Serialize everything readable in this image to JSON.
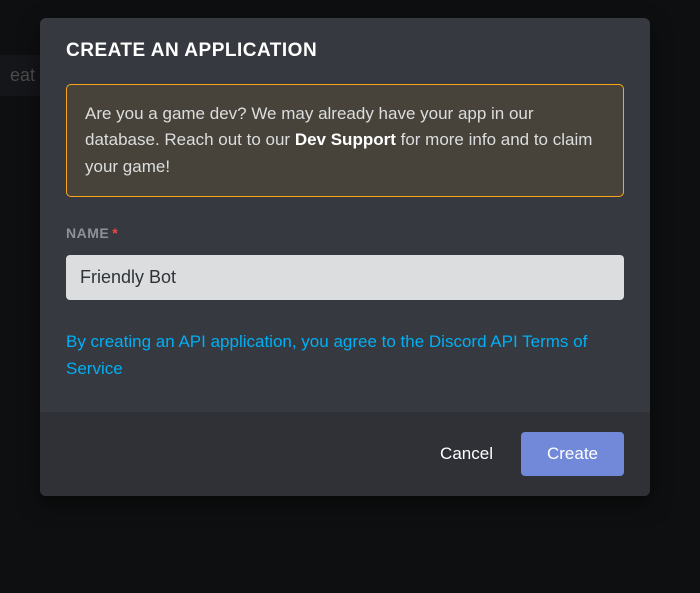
{
  "background": {
    "partial_text": "eat"
  },
  "modal": {
    "title": "CREATE AN APPLICATION",
    "notice": {
      "text_before": "Are you a game dev? We may already have your app in our database. Reach out to our ",
      "bold_text": "Dev Support",
      "text_after": " for more info and to claim your game!"
    },
    "name_field": {
      "label": "NAME",
      "required_marker": "*",
      "value": "Friendly Bot"
    },
    "agreement": {
      "text": "By creating an API application, you agree to the Discord API Terms of Service"
    },
    "footer": {
      "cancel_label": "Cancel",
      "create_label": "Create"
    }
  },
  "colors": {
    "accent": "#7289da",
    "warning_border": "#faa61a",
    "link": "#00aff4",
    "required": "#f04747"
  }
}
